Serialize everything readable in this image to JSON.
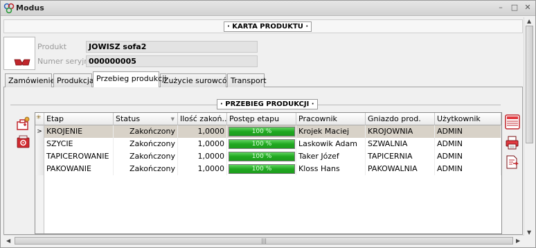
{
  "window": {
    "title": "Modus",
    "minimize": "–",
    "restore": "□",
    "close": "✕"
  },
  "header": {
    "title": "KARTA PRODUKTU"
  },
  "product": {
    "product_label": "Produkt",
    "product_value": "JOWISZ sofa2",
    "serial_label": "Numer seryjny",
    "serial_value": "000000005"
  },
  "tabs": [
    {
      "label": "Zamówienie"
    },
    {
      "label": "Produkcja"
    },
    {
      "label": "Przebieg produkcji"
    },
    {
      "label": "Zużycie surowców"
    },
    {
      "label": "Transport"
    }
  ],
  "active_tab": "Przebieg produkcji",
  "section": {
    "title": "PRZEBIEG PRODUKCJI"
  },
  "grid": {
    "corner_symbol": "✳",
    "columns": [
      "Etap",
      "Status",
      "Ilość zakoń...",
      "Postęp etapu",
      "Pracownik",
      "Gniazdo prod.",
      "Użytkownik"
    ],
    "rows": [
      {
        "etap": "KROJENIE",
        "status": "Zakończony",
        "ilosc": "1,0000",
        "postep": "100 %",
        "postep_value": 100,
        "pracownik": "Krojek Maciej",
        "gniazdo": "KROJOWNIA",
        "uzytkownik": "ADMIN",
        "selected": true
      },
      {
        "etap": "SZYCIE",
        "status": "Zakończony",
        "ilosc": "1,0000",
        "postep": "100 %",
        "postep_value": 100,
        "pracownik": "Laskowik Adam",
        "gniazdo": "SZWALNIA",
        "uzytkownik": "ADMIN"
      },
      {
        "etap": "TAPICEROWANIE",
        "status": "Zakończony",
        "ilosc": "1,0000",
        "postep": "100 %",
        "postep_value": 100,
        "pracownik": "Taker Józef",
        "gniazdo": "TAPICERNIA",
        "uzytkownik": "ADMIN"
      },
      {
        "etap": "PAKOWANIE",
        "status": "Zakończony",
        "ilosc": "1,0000",
        "postep": "100 %",
        "postep_value": 100,
        "pracownik": "Kloss Hans",
        "gniazdo": "PAKOWALNIA",
        "uzytkownik": "ADMIN"
      }
    ],
    "selected_marker": ">"
  },
  "scrollbar": {
    "up": "▲",
    "down": "▼",
    "left": "◀",
    "right": "▶",
    "grip": "|||"
  },
  "colors": {
    "progress": "#20a820",
    "selected_row": "#d8d2c8",
    "icon_red": "#c0262c"
  }
}
